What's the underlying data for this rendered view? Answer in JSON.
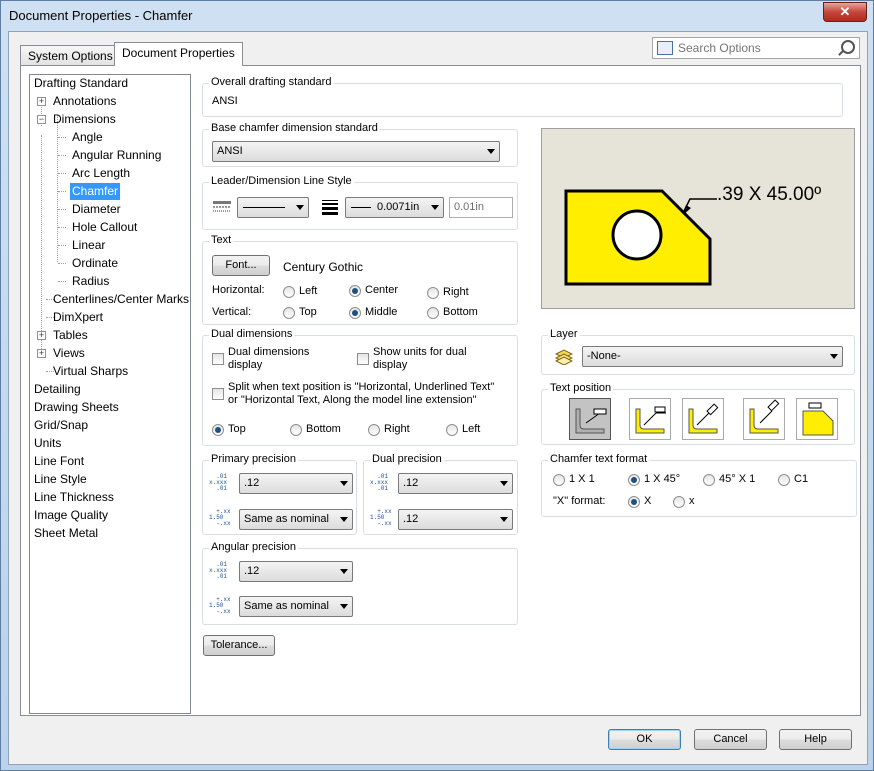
{
  "window": {
    "title": "Document Properties - Chamfer",
    "close": "✕"
  },
  "tabs": [
    {
      "label": "System Options"
    },
    {
      "label": "Document Properties"
    }
  ],
  "search": {
    "placeholder": "Search Options"
  },
  "tree": {
    "items": [
      {
        "label": "Drafting Standard"
      },
      {
        "label": "Annotations"
      },
      {
        "label": "Dimensions"
      },
      {
        "label": "Angle"
      },
      {
        "label": "Angular Running"
      },
      {
        "label": "Arc Length"
      },
      {
        "label": "Chamfer"
      },
      {
        "label": "Diameter"
      },
      {
        "label": "Hole Callout"
      },
      {
        "label": "Linear"
      },
      {
        "label": "Ordinate"
      },
      {
        "label": "Radius"
      },
      {
        "label": "Centerlines/Center Marks"
      },
      {
        "label": "DimXpert"
      },
      {
        "label": "Tables"
      },
      {
        "label": "Views"
      },
      {
        "label": "Virtual Sharps"
      },
      {
        "label": "Detailing"
      },
      {
        "label": "Drawing Sheets"
      },
      {
        "label": "Grid/Snap"
      },
      {
        "label": "Units"
      },
      {
        "label": "Line Font"
      },
      {
        "label": "Line Style"
      },
      {
        "label": "Line Thickness"
      },
      {
        "label": "Image Quality"
      },
      {
        "label": "Sheet Metal"
      }
    ]
  },
  "overall": {
    "title": "Overall drafting standard",
    "value": "ANSI"
  },
  "base": {
    "title": "Base chamfer dimension standard",
    "value": "ANSI"
  },
  "leader": {
    "title": "Leader/Dimension Line Style",
    "thickness": "0.0071in",
    "custom": "0.01in"
  },
  "text": {
    "title": "Text",
    "font_button": "Font...",
    "font_name": "Century Gothic",
    "horizontal_label": "Horizontal:",
    "left": "Left",
    "center": "Center",
    "right": "Right",
    "vertical_label": "Vertical:",
    "top": "Top",
    "middle": "Middle",
    "bottom": "Bottom"
  },
  "dual": {
    "title": "Dual dimensions",
    "display_line1": "Dual dimensions",
    "display_line2": "display",
    "units_line1": "Show units for dual",
    "units_line2": "display",
    "split_line1": "Split when text position is \"Horizontal, Underlined Text\"",
    "split_line2": "or \"Horizontal Text, Along the model line extension\"",
    "top": "Top",
    "bottom": "Bottom",
    "right": "Right",
    "left": "Left"
  },
  "primary": {
    "title": "Primary precision",
    "value": ".12",
    "tolerance": "Same as nominal"
  },
  "dual_precision": {
    "title": "Dual precision",
    "value": ".12",
    "tolerance": ".12"
  },
  "angular": {
    "title": "Angular precision",
    "value": ".12",
    "tolerance": "Same as nominal"
  },
  "tolerance_button": "Tolerance...",
  "preview": {
    "dimension_text": ".39 X 45.00º"
  },
  "layer": {
    "title": "Layer",
    "value": "-None-"
  },
  "text_position": {
    "title": "Text position"
  },
  "chamfer_format": {
    "title": "Chamfer text format",
    "opt1": "1 X 1",
    "opt2": "1 X 45°",
    "opt3": "45° X 1",
    "opt4": "C1",
    "x_format_label": "\"X\" format:",
    "x_upper": "X",
    "x_lower": "x"
  },
  "buttons": {
    "ok": "OK",
    "cancel": "Cancel",
    "help": "Help"
  },
  "colors": {
    "selection": "#3399ff",
    "part_fill": "#ffee00",
    "preview_bg": "#e6e4d8"
  }
}
